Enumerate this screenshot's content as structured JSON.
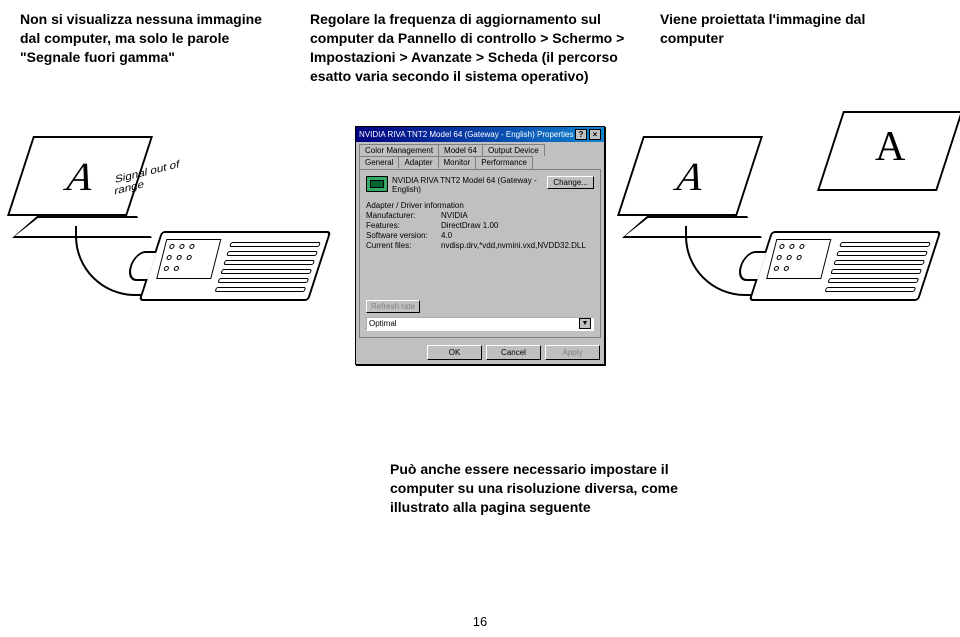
{
  "header": {
    "left": "Non si visualizza nessuna immagine dal computer, ma solo le parole \"Segnale fuori gamma\"",
    "mid": "Regolare la frequenza di aggiornamento sul computer da Pannello di controllo > Schermo > Impostazioni > Avanzate > Scheda (il percorso esatto varia secondo il sistema operativo)",
    "right": "Viene proiettata l'immagine dal computer"
  },
  "laptop_signal": "Signal out of\nrange",
  "letter_a": "A",
  "dialog": {
    "title": "NVIDIA RIVA TNT2 Model 64 (Gateway - English) Properties",
    "tabs_row1": [
      "Color Management",
      "Model 64",
      "Output Device"
    ],
    "tabs_row2": [
      "General",
      "Adapter",
      "Monitor",
      "Performance"
    ],
    "active_tab": "Adapter",
    "driver_name": "NVIDIA RIVA TNT2 Model 64 (Gateway - English)",
    "change_btn": "Change...",
    "section": "Adapter / Driver information",
    "kv": [
      {
        "k": "Manufacturer:",
        "v": "NVIDIA"
      },
      {
        "k": "Features:",
        "v": "DirectDraw 1.00"
      },
      {
        "k": "Software version:",
        "v": "4.0"
      },
      {
        "k": "Current files:",
        "v": "nvdisp.drv,*vdd,nvmini.vxd,NVDD32.DLL"
      }
    ],
    "refresh_label": "Refresh rate",
    "combo_value": "Optimal",
    "ok": "OK",
    "cancel": "Cancel",
    "apply": "Apply"
  },
  "caption": "Può anche essere necessario impostare il computer su una risoluzione diversa, come illustrato alla pagina seguente",
  "page_num": "16"
}
